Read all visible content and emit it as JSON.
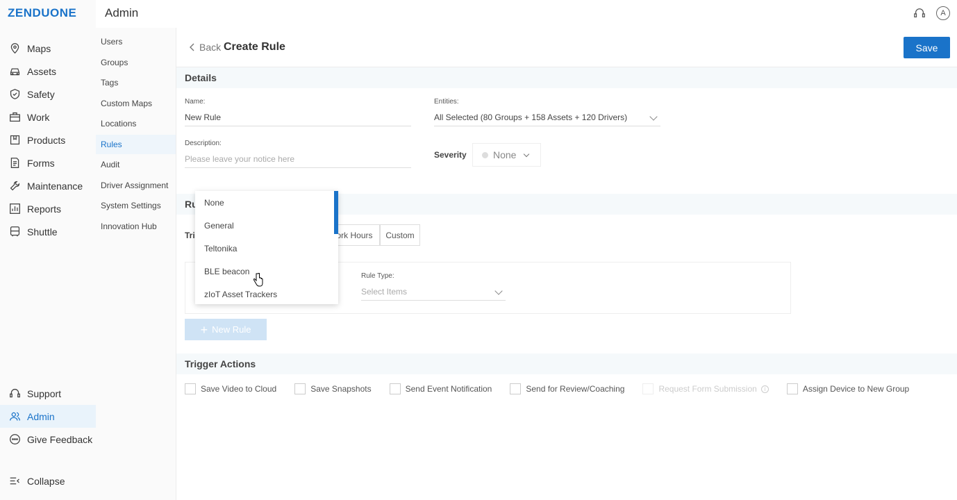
{
  "brand": {
    "logo": "ZENDUONE",
    "accent": "#1a73c9"
  },
  "sidebar": {
    "items": [
      {
        "label": "Maps",
        "icon": "map-pin-icon"
      },
      {
        "label": "Assets",
        "icon": "car-icon"
      },
      {
        "label": "Safety",
        "icon": "shield-icon"
      },
      {
        "label": "Work",
        "icon": "briefcase-icon"
      },
      {
        "label": "Products",
        "icon": "box-icon"
      },
      {
        "label": "Forms",
        "icon": "document-icon"
      },
      {
        "label": "Maintenance",
        "icon": "wrench-icon"
      },
      {
        "label": "Reports",
        "icon": "bar-chart-icon"
      },
      {
        "label": "Shuttle",
        "icon": "bus-icon"
      }
    ],
    "bottom": [
      {
        "label": "Support",
        "icon": "headset-icon"
      },
      {
        "label": "Admin",
        "icon": "users-icon"
      },
      {
        "label": "Give Feedback",
        "icon": "chat-icon"
      }
    ],
    "collapse": "Collapse"
  },
  "admin": {
    "title": "Admin",
    "items": [
      "Users",
      "Groups",
      "Tags",
      "Custom Maps",
      "Locations",
      "Rules",
      "Audit",
      "Driver Assignment",
      "System Settings",
      "Innovation Hub"
    ],
    "active": "Rules"
  },
  "topbar": {
    "avatar": "A"
  },
  "header": {
    "back": "Back",
    "title": "Create Rule",
    "save": "Save"
  },
  "details": {
    "section": "Details",
    "name_label": "Name:",
    "name_value": "New Rule",
    "desc_label": "Description:",
    "desc_placeholder": "Please leave your notice here",
    "entities_label": "Entities:",
    "entities_value": "All Selected (80 Groups + 158 Assets + 120 Drivers)",
    "severity_label": "Severity",
    "severity_value": "None"
  },
  "rules": {
    "section_partial": "Ru",
    "trigger_partial": "Tri",
    "tabs": [
      "ork Hours",
      "Custom"
    ],
    "rule_type_label": "Rule Type:",
    "rule_type_placeholder": "Select Items",
    "new_rule": "New Rule"
  },
  "dropdown": {
    "options": [
      "None",
      "General",
      "Teltonika",
      "BLE beacon",
      "zIoT Asset Trackers"
    ]
  },
  "trigger_actions": {
    "section": "Trigger Actions",
    "items": [
      {
        "label": "Save Video to Cloud",
        "enabled": true
      },
      {
        "label": "Save Snapshots",
        "enabled": true
      },
      {
        "label": "Send Event Notification",
        "enabled": true
      },
      {
        "label": "Send for Review/Coaching",
        "enabled": true
      },
      {
        "label": "Request Form Submission",
        "enabled": false
      },
      {
        "label": "Assign Device to New Group",
        "enabled": true
      }
    ]
  }
}
